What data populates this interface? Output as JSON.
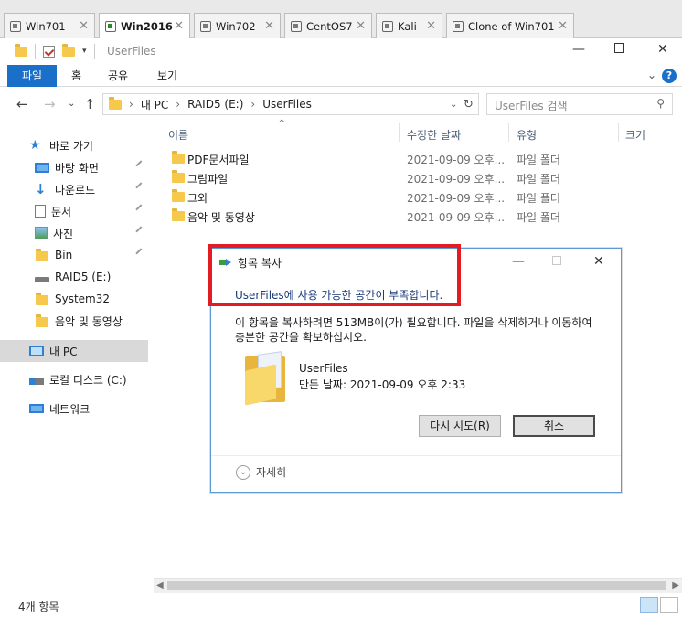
{
  "vm_tabs": [
    {
      "label": "Win701",
      "active": false
    },
    {
      "label": "Win2016",
      "active": true
    },
    {
      "label": "Win702",
      "active": false
    },
    {
      "label": "CentOS7",
      "active": false
    },
    {
      "label": "Kali",
      "active": false
    },
    {
      "label": "Clone of Win701",
      "active": false
    }
  ],
  "window": {
    "title": "UserFiles"
  },
  "ribbon": {
    "tabs": [
      "파일",
      "홈",
      "공유",
      "보기"
    ],
    "help": "?"
  },
  "address": {
    "crumbs": [
      "내 PC",
      "RAID5 (E:)",
      "UserFiles"
    ],
    "search_placeholder": "UserFiles 검색"
  },
  "nav": {
    "items": [
      {
        "label": "바로 가기",
        "icon": "star-icon"
      },
      {
        "label": "바탕 화면",
        "icon": "desktop-icon"
      },
      {
        "label": "다운로드",
        "icon": "download-icon"
      },
      {
        "label": "문서",
        "icon": "document-icon"
      },
      {
        "label": "사진",
        "icon": "pictures-icon"
      },
      {
        "label": "Bin",
        "icon": "folder-icon"
      },
      {
        "label": "RAID5 (E:)",
        "icon": "drive-icon"
      },
      {
        "label": "System32",
        "icon": "folder-icon"
      },
      {
        "label": "음악 및 동영상",
        "icon": "folder-icon"
      },
      {
        "label": "내 PC",
        "icon": "pc-icon"
      },
      {
        "label": "로컬 디스크 (C:)",
        "icon": "drive-c-icon"
      },
      {
        "label": "네트워크",
        "icon": "network-icon"
      }
    ]
  },
  "columns": {
    "name": "이름",
    "date": "수정한 날짜",
    "type": "유형",
    "size": "크기"
  },
  "files": [
    {
      "name": "PDF문서파일",
      "date": "2021-09-09 오후...",
      "type": "파일 폴더"
    },
    {
      "name": "그림파일",
      "date": "2021-09-09 오후...",
      "type": "파일 폴더"
    },
    {
      "name": "그외",
      "date": "2021-09-09 오후...",
      "type": "파일 폴더"
    },
    {
      "name": "음악 및 동영상",
      "date": "2021-09-09 오후...",
      "type": "파일 폴더"
    }
  ],
  "status": {
    "count": "4개 항목"
  },
  "dialog": {
    "title": "항목 복사",
    "heading": "UserFiles에 사용 가능한 공간이 부족합니다.",
    "message": "이 항목을 복사하려면 513MB이(가) 필요합니다. 파일을 삭제하거나 이동하여 충분한 공간을 확보하십시오.",
    "file_name": "UserFiles",
    "file_date": "만든 날짜: 2021-09-09 오후 2:33",
    "retry_label": "다시 시도(R)",
    "cancel_label": "취소",
    "details_label": "자세히"
  },
  "colors": {
    "accent": "#1a6fc9",
    "annotation": "#e21c22",
    "folder": "#f6c94c"
  }
}
